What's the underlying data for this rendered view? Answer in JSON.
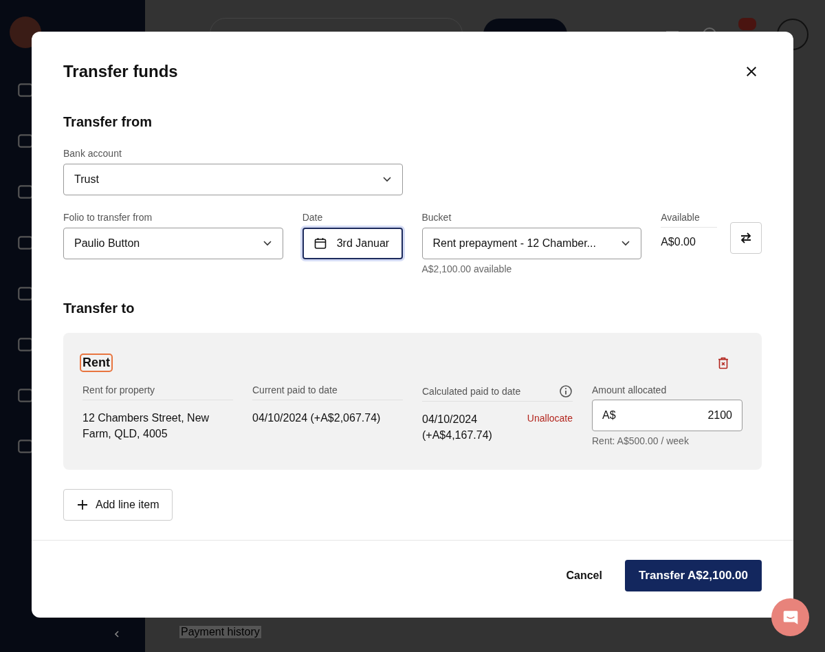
{
  "background": {
    "tab": "Payment history"
  },
  "modal": {
    "title": "Transfer funds",
    "transfer_from": {
      "heading": "Transfer from",
      "bank_account": {
        "label": "Bank account",
        "value": "Trust"
      },
      "folio": {
        "label": "Folio to transfer from",
        "value": "Paulio Button"
      },
      "date": {
        "label": "Date",
        "value": "3rd Januar",
        "focused": true
      },
      "bucket": {
        "label": "Bucket",
        "value": "Rent prepayment - 12 Chamber...",
        "hint": "A$2,100.00 available"
      },
      "available": {
        "label": "Available",
        "value": "A$0.00"
      }
    },
    "transfer_to": {
      "heading": "Transfer to",
      "line_items": [
        {
          "title": "Rent",
          "focused": true,
          "property_label": "Rent for property",
          "property_value": "12 Chambers Street, New Farm, QLD, 4005",
          "current_label": "Current paid to date",
          "current_value": "04/10/2024 (+A$2,067.74)",
          "calculated_label": "Calculated paid to date",
          "calculated_value": "04/10/2024 (+A$4,167.74)",
          "unallocate_link": "Unallocate",
          "amount_label": "Amount allocated",
          "amount_prefix": "A$",
          "amount_value": "2100",
          "amount_hint": "Rent: A$500.00 / week"
        }
      ]
    },
    "add_line_item": "Add line item",
    "cancel": "Cancel",
    "submit": "Transfer A$2,100.00"
  }
}
